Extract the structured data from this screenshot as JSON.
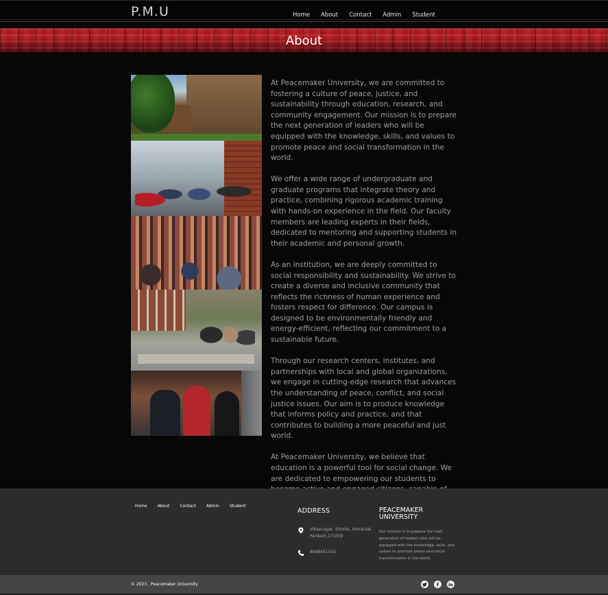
{
  "header": {
    "logo": "P.M.U",
    "nav": [
      "Home",
      "About",
      "Contact",
      "Admin",
      "Student"
    ]
  },
  "banner": {
    "title": "About"
  },
  "gallery": {
    "icons": [
      "campus-building-photo",
      "students-hallway-photo",
      "lecture-audience-photo",
      "students-courtyard-photo",
      "students-portrait-photo"
    ]
  },
  "article": {
    "paragraphs": [
      "At Peacemaker University, we are committed to fostering a culture of peace, justice, and sustainability through education, research, and community engagement. Our mission is to prepare the next generation of leaders who will be equipped with the knowledge, skills, and values to promote peace and social transformation in the world.",
      "We offer a wide range of undergraduate and graduate programs that integrate theory and practice, combining rigorous academic training with hands-on experience in the field. Our faculty members are leading experts in their fields, dedicated to mentoring and supporting students in their academic and personal growth.",
      "As an institution, we are deeply committed to social responsibility and sustainability. We strive to create a diverse and inclusive community that reflects the richness of human experience and fosters respect for difference. Our campus is designed to be environmentally friendly and energy-efficient, reflecting our commitment to a sustainable future.",
      "Through our research centers, institutes, and partnerships with local and global organizations, we engage in cutting-edge research that advances the understanding of peace, conflict, and social justice issues. Our aim is to produce knowledge that informs policy and practice, and that contributes to building a more peaceful and just world.",
      "At Peacemaker University, we believe that education is a powerful tool for social change. We are dedicated to empowering our students to become active and engaged citizens, capable of making a positive impact in their communities and the world at large."
    ]
  },
  "footer": {
    "nav": [
      "Home",
      "About",
      "Contact",
      "Admin",
      "Student"
    ],
    "address_heading": "ADDRESS",
    "address": "Vikasnagar, Shimla, Himachal Pardesh,171009",
    "phone": "8948451542",
    "about_heading": "PEACEMAKER UNIVERSITY",
    "about_text": "Our mission is to prepare the next generation of leaders who will be equipped with the knowledge, skills, and values to promote peace and social transformation in the world.",
    "copyright": "© 2023 , Peacemaker University",
    "social": [
      "twitter-icon",
      "facebook-icon",
      "linkedin-icon"
    ]
  },
  "colors": {
    "page_bg": "#070707",
    "banner_red": "#b11a1e",
    "footer_bg": "#2c2c2c",
    "bottombar_bg": "#454545",
    "body_text": "#9ba0a4"
  }
}
